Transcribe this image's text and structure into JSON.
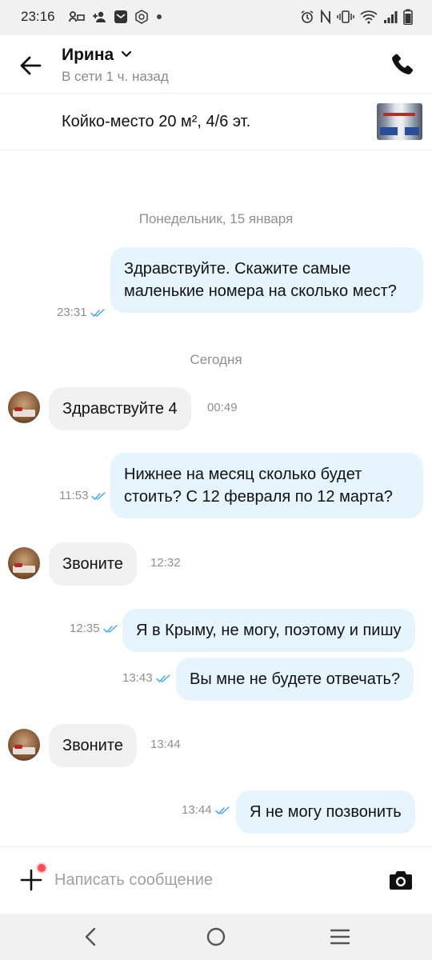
{
  "status_bar": {
    "time": "23:16",
    "left_icons": [
      "voicemail-icon",
      "add-person-icon",
      "mail-icon",
      "vpn-badge-icon",
      "dot-icon"
    ],
    "right_icons": [
      "alarm-icon",
      "nfc-icon",
      "vibrate-icon",
      "wifi-icon",
      "signal-icon",
      "battery-icon"
    ]
  },
  "header": {
    "contact_name": "Ирина",
    "status": "В сети 1 ч. назад"
  },
  "listing": {
    "title": "Койко-место 20 м², 4/6 эт."
  },
  "chat": {
    "date_separators": [
      "Понедельник, 15 января",
      "Сегодня"
    ],
    "messages": [
      {
        "direction": "out",
        "text": "Здравствуйте. Скажите самые маленькие номера на сколько мест?",
        "time": "23:31",
        "read": true
      },
      {
        "direction": "in",
        "text": "Здравствуйте 4",
        "time": "00:49"
      },
      {
        "direction": "out",
        "text": "Нижнее на месяц сколько будет стоить? С 12 февраля по 12 марта?",
        "time": "11:53",
        "read": true
      },
      {
        "direction": "in",
        "text": "Звоните",
        "time": "12:32"
      },
      {
        "direction": "out",
        "text": "Я в Крыму, не могу, поэтому и пишу",
        "time": "12:35",
        "read": true
      },
      {
        "direction": "out",
        "text": "Вы мне не будете отвечать?",
        "time": "13:43",
        "read": true
      },
      {
        "direction": "in",
        "text": "Звоните",
        "time": "13:44"
      },
      {
        "direction": "out",
        "text": "Я не могу позвонить",
        "time": "13:44",
        "read": true
      }
    ]
  },
  "composer": {
    "placeholder": "Написать сообщение",
    "value": ""
  },
  "colors": {
    "outgoing_bubble": "#e5f4fd",
    "incoming_bubble": "#f1f1f1",
    "read_ticks": "#4aa8ee",
    "notification_dot": "#ff4d57"
  },
  "nav_bar": {
    "buttons": [
      "back-icon",
      "home-icon",
      "recents-icon"
    ]
  }
}
